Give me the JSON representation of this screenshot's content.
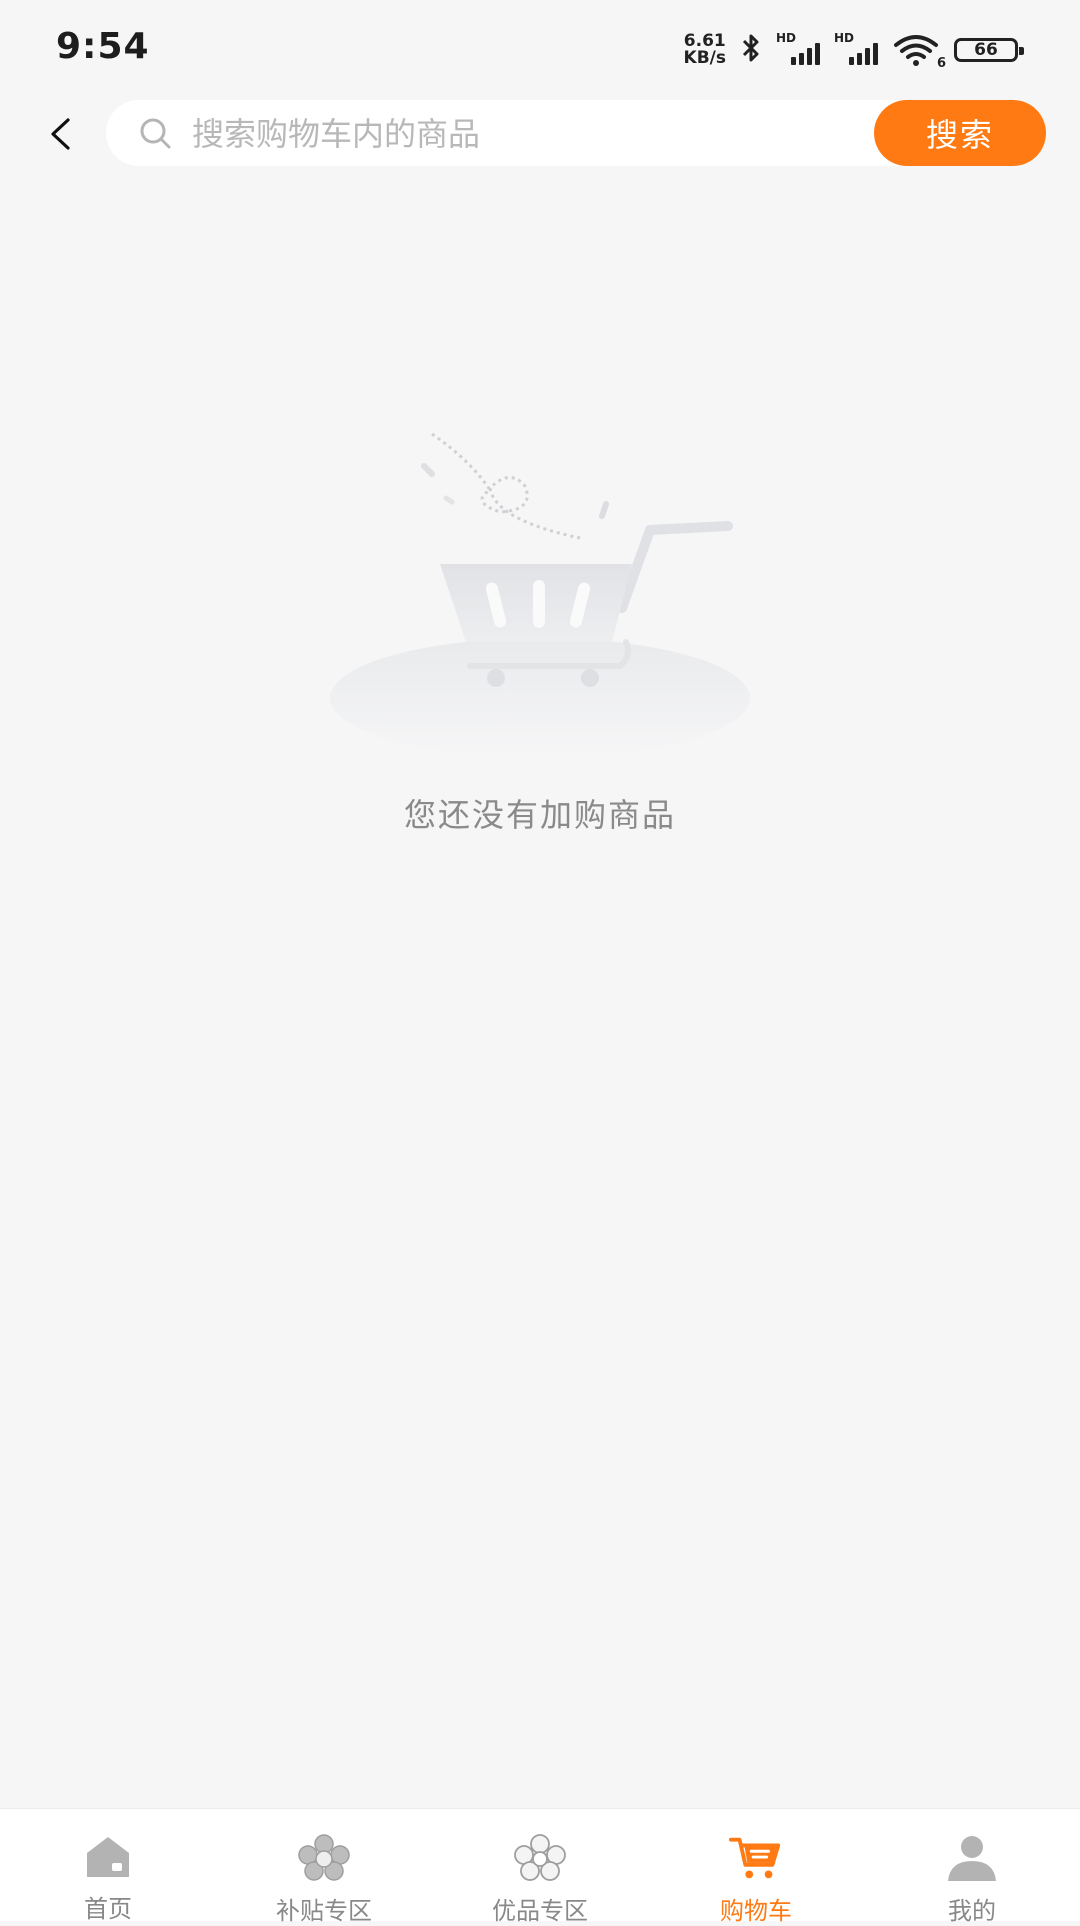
{
  "status_bar": {
    "time": "9:54",
    "net_speed_value": "6.61",
    "net_speed_unit": "KB/s",
    "signal_label_1": "HD",
    "signal_label_2": "HD",
    "wifi_label": "6",
    "battery": "66"
  },
  "search": {
    "placeholder": "搜索购物车内的商品",
    "button_label": "搜索"
  },
  "empty_state": {
    "message": "您还没有加购商品"
  },
  "tabs": [
    {
      "label": "首页",
      "icon": "home-icon",
      "active": false
    },
    {
      "label": "补贴专区",
      "icon": "subsidy-icon",
      "active": false
    },
    {
      "label": "优品专区",
      "icon": "quality-goods-icon",
      "active": false
    },
    {
      "label": "购物车",
      "icon": "cart-icon",
      "active": true
    },
    {
      "label": "我的",
      "icon": "profile-icon",
      "active": false
    }
  ],
  "colors": {
    "accent": "#ff7a12",
    "background": "#f6f6f7",
    "tab_inactive": "#888888"
  }
}
